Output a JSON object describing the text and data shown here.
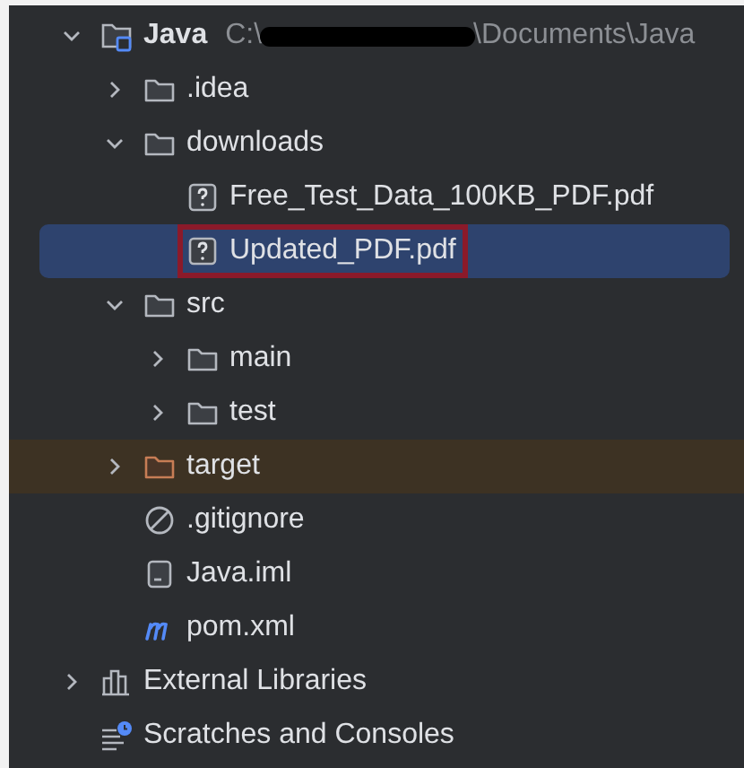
{
  "tree": [
    {
      "label": "Java",
      "kind": "module",
      "path_start": "C:\\",
      "path_end": "\\Documents\\Java",
      "redacted": true,
      "expanded": true,
      "selected": false,
      "children": [
        {
          "label": ".idea",
          "kind": "folder",
          "expanded": false,
          "selected": false
        },
        {
          "label": "downloads",
          "kind": "folder",
          "expanded": true,
          "selected": false,
          "children": [
            {
              "label": "Free_Test_Data_100KB_PDF.pdf",
              "kind": "unknown",
              "selected": false
            },
            {
              "label": "Updated_PDF.pdf",
              "kind": "unknown",
              "selected": true,
              "highlighted": true
            }
          ]
        },
        {
          "label": "src",
          "kind": "folder",
          "expanded": true,
          "selected": false,
          "children": [
            {
              "label": "main",
              "kind": "folder",
              "expanded": false,
              "selected": false
            },
            {
              "label": "test",
              "kind": "folder",
              "expanded": false,
              "selected": false
            }
          ]
        },
        {
          "label": "target",
          "kind": "folder",
          "expanded": false,
          "selected": false,
          "excluded": true
        },
        {
          "label": ".gitignore",
          "kind": "ignore",
          "selected": false
        },
        {
          "label": "Java.iml",
          "kind": "iml",
          "selected": false
        },
        {
          "label": "pom.xml",
          "kind": "maven",
          "selected": false
        }
      ]
    },
    {
      "label": "External Libraries",
      "kind": "libraries",
      "expanded": false,
      "selected": false
    },
    {
      "label": "Scratches and Consoles",
      "kind": "scratches",
      "selected": false
    }
  ]
}
